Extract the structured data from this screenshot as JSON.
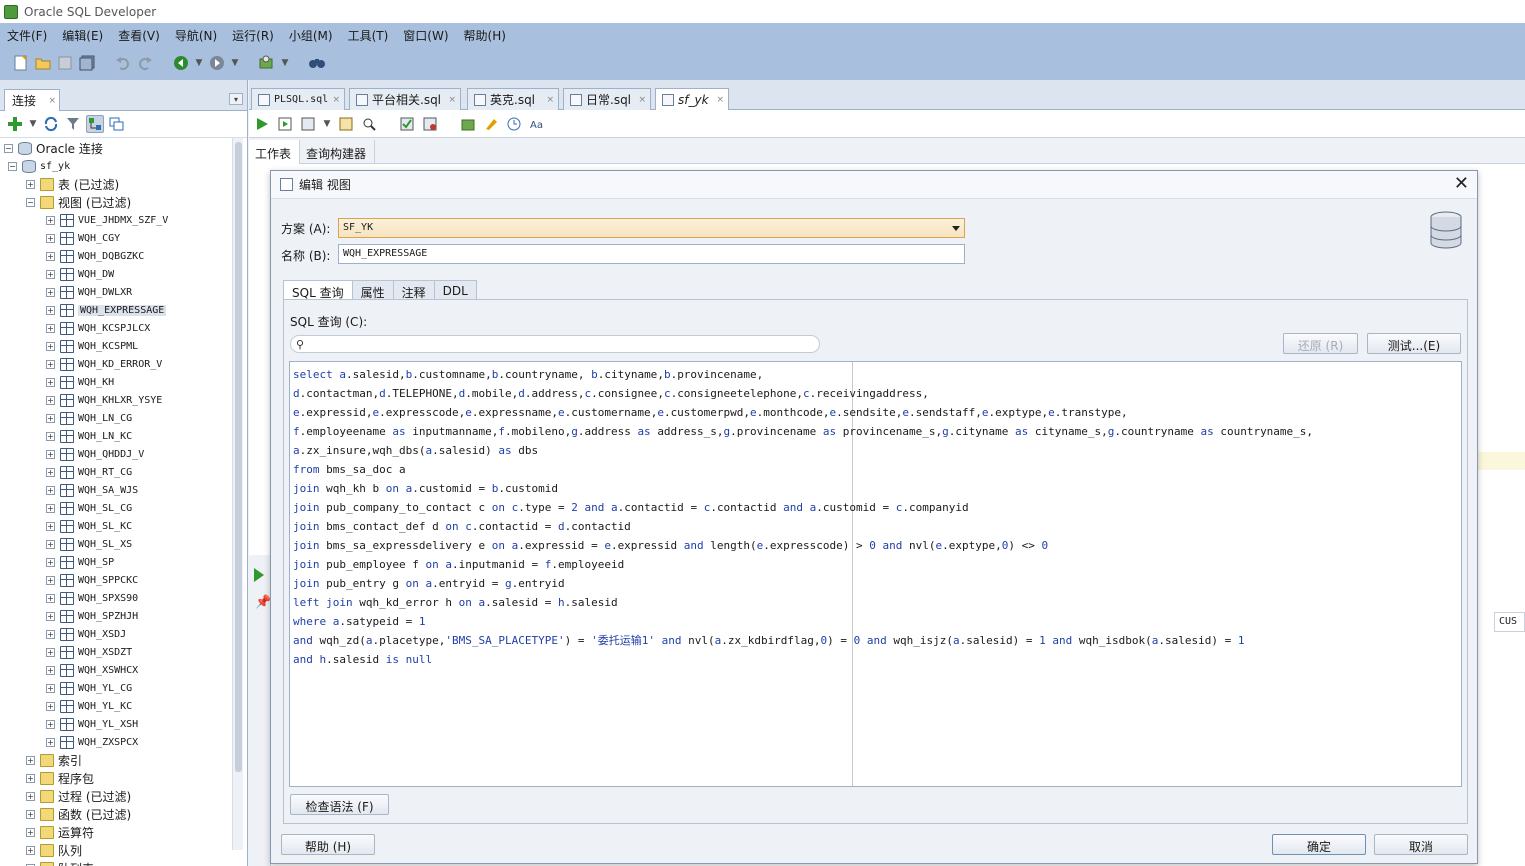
{
  "window": {
    "title": "Oracle SQL Developer"
  },
  "menu": [
    "文件(F)",
    "编辑(E)",
    "查看(V)",
    "导航(N)",
    "运行(R)",
    "小组(M)",
    "工具(T)",
    "窗口(W)",
    "帮助(H)"
  ],
  "left_panel": {
    "tab_label": "连接",
    "tab_close": "×",
    "minimize": "▾",
    "tree": {
      "root": "Oracle 连接",
      "connection": "sf_yk",
      "tables": "表 (已过滤)",
      "views": "视图 (已过滤)",
      "view_items": [
        "VUE_JHDMX_SZF_V",
        "WQH_CGY",
        "WQH_DQBGZKC",
        "WQH_DW",
        "WQH_DWLXR",
        "WQH_EXPRESSAGE",
        "WQH_KCSPJLCX",
        "WQH_KCSPML",
        "WQH_KD_ERROR_V",
        "WQH_KH",
        "WQH_KHLXR_YSYE",
        "WQH_LN_CG",
        "WQH_LN_KC",
        "WQH_QHDDJ_V",
        "WQH_RT_CG",
        "WQH_SA_WJS",
        "WQH_SL_CG",
        "WQH_SL_KC",
        "WQH_SL_XS",
        "WQH_SP",
        "WQH_SPPCKC",
        "WQH_SPXS90",
        "WQH_SPZHJH",
        "WQH_XSDJ",
        "WQH_XSDZT",
        "WQH_XSWHCX",
        "WQH_YL_CG",
        "WQH_YL_KC",
        "WQH_YL_XSH",
        "WQH_ZXSPCX"
      ],
      "selected_view": "WQH_EXPRESSAGE",
      "other_nodes": [
        "索引",
        "程序包",
        "过程 (已过滤)",
        "函数 (已过滤)",
        "运算符",
        "队列",
        "队列表"
      ]
    }
  },
  "editor_tabs": [
    {
      "label": "PLSQL.sql",
      "active": false
    },
    {
      "label": "平台相关.sql",
      "active": false
    },
    {
      "label": "英克.sql",
      "active": false
    },
    {
      "label": "日常.sql",
      "active": false
    },
    {
      "label": "sf_yk",
      "active": true
    }
  ],
  "tab_close": "×",
  "worksheet_tabs": [
    "工作表",
    "查询构建器"
  ],
  "right_hint": "CUS",
  "dialog": {
    "title": "编辑 视图",
    "close": "✕",
    "schema_label": "方案 (A):",
    "schema_value": "SF_YK",
    "name_label": "名称 (B):",
    "name_value": "WQH_EXPRESSAGE",
    "tabs": [
      "SQL 查询",
      "属性",
      "注释",
      "DDL"
    ],
    "active_tab": "SQL 查询",
    "sql_label": "SQL 查询 (C):",
    "search_placeholder": "",
    "revert_button": "还原 (R)",
    "test_button": "测试...(E)",
    "check_syntax_button": "检查语法 (F)",
    "help_button": "帮助 (H)",
    "ok_button": "确定",
    "cancel_button": "取消",
    "sql_lines": [
      "select a.salesid,b.customname,b.countryname, b.cityname,b.provincename,",
      "d.contactman,d.TELEPHONE,d.mobile,d.address,c.consignee,c.consigneetelephone,c.receivingaddress,",
      "e.expressid,e.expresscode,e.expressname,e.customername,e.customerpwd,e.monthcode,e.sendsite,e.sendstaff,e.exptype,e.transtype,",
      "f.employeename as inputmanname,f.mobileno,g.address as address_s,g.provincename as provincename_s,g.cityname as cityname_s,g.countryname as countryname_s,",
      "a.zx_insure,wqh_dbs(a.salesid) as dbs",
      "from bms_sa_doc a",
      "join wqh_kh b on a.customid = b.customid",
      "join pub_company_to_contact c on c.type = 2 and a.contactid = c.contactid and a.customid = c.companyid",
      "join bms_contact_def d on c.contactid = d.contactid",
      "join bms_sa_expressdelivery e on a.expressid = e.expressid and length(e.expresscode) > 0 and nvl(e.exptype,0) <> 0",
      "join pub_employee f on a.inputmanid = f.employeeid",
      "join pub_entry g on a.entryid = g.entryid",
      "left join wqh_kd_error h on a.salesid = h.salesid",
      "where a.satypeid = 1",
      "and wqh_zd(a.placetype,'BMS_SA_PLACETYPE') = '委托运输1' and nvl(a.zx_kdbirdflag,0) = 0 and wqh_isjz(a.salesid) = 1 and wqh_isdbok(a.salesid) = 1",
      "and h.salesid is null"
    ]
  },
  "colors": {
    "chrome": "#a8c0dd",
    "keyword": "#1f3fa8",
    "schema_highlight": "#f7e3bd"
  },
  "icons": [
    "app-icon",
    "new-file-icon",
    "open-folder-icon",
    "save-icon",
    "save-all-icon",
    "undo-icon",
    "redo-icon",
    "back-icon",
    "forward-icon",
    "run-icon",
    "binoculars-icon",
    "add-connection-icon",
    "refresh-icon",
    "filter-icon",
    "schema-browser-icon",
    "database-icon",
    "close-icon"
  ]
}
